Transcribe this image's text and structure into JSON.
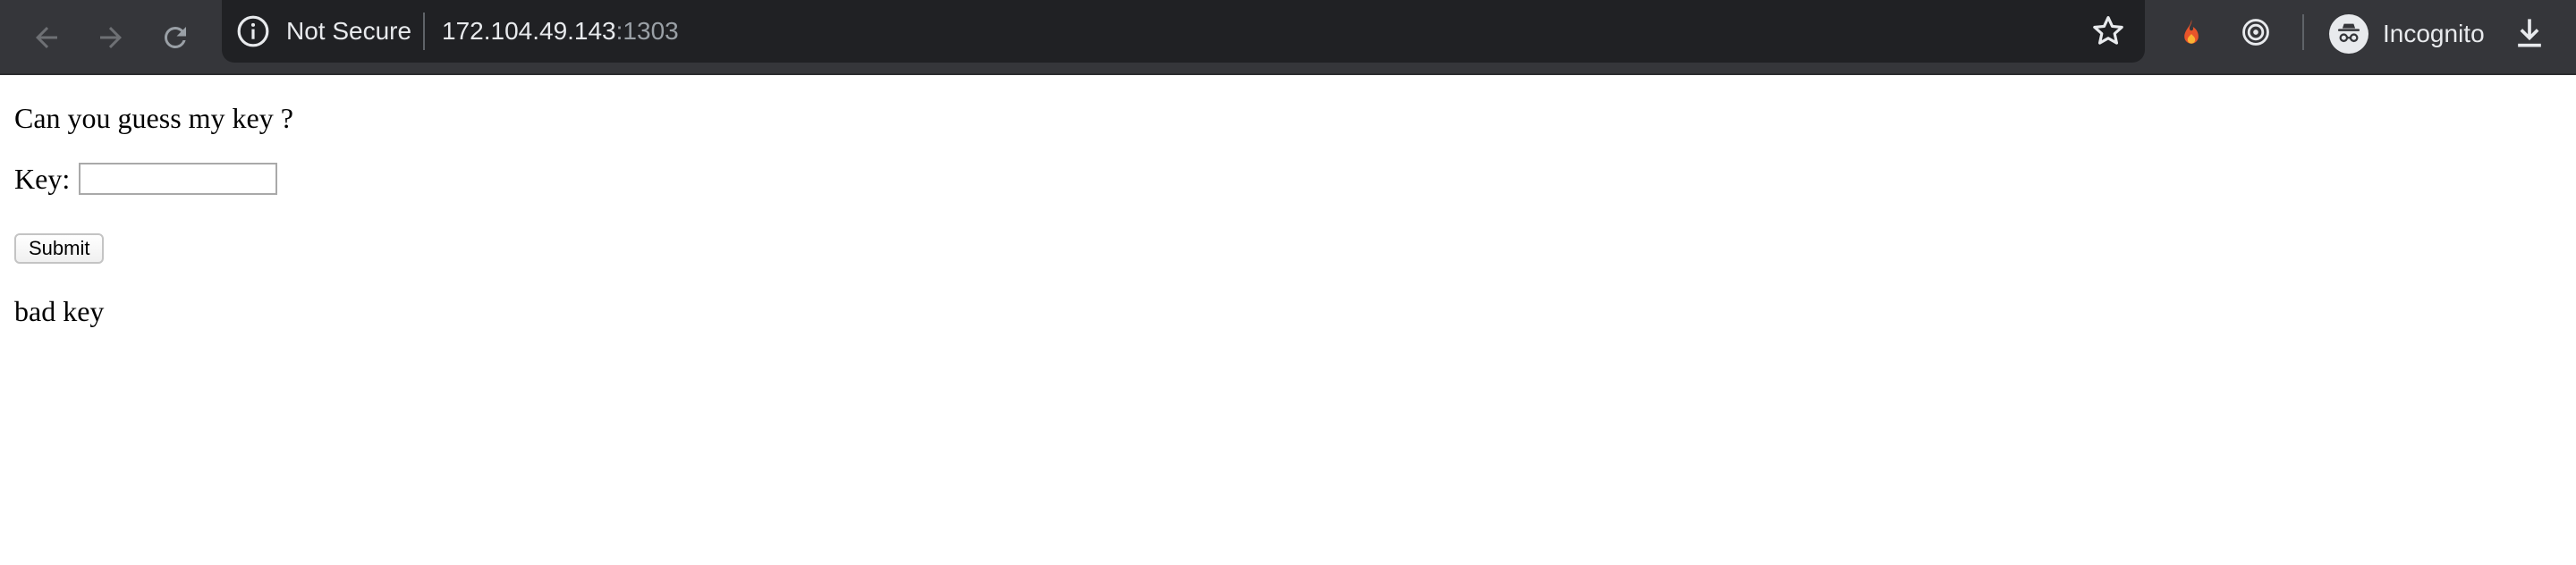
{
  "browser": {
    "security_label": "Not Secure",
    "url_host": "172.104.49.143",
    "url_port": ":1303",
    "profile_label": "Incognito",
    "colors": {
      "toolbar": "#35363a",
      "omnibox": "#202124",
      "text": "#e8eaed",
      "muted": "#9aa0a6"
    },
    "icons": {
      "back": "arrow-left-icon",
      "forward": "arrow-right-icon",
      "reload": "reload-icon",
      "info": "info-icon",
      "bookmark": "star-icon",
      "extension_1": "fire-icon",
      "extension_2": "target-icon",
      "profile": "incognito-icon",
      "downloads": "download-icon"
    }
  },
  "page": {
    "prompt": "Can you guess my key ?",
    "key_label": "Key:",
    "key_value": "",
    "submit_label": "Submit",
    "result": "bad key"
  }
}
